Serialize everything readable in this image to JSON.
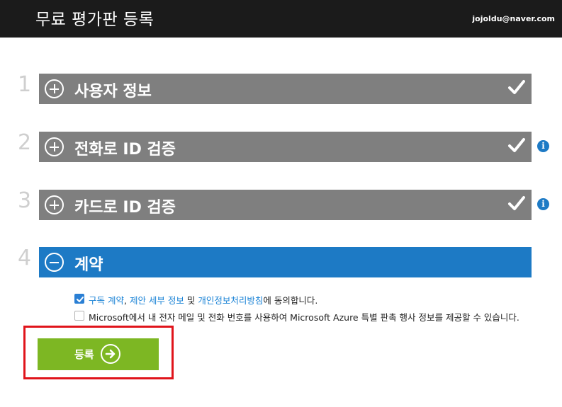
{
  "header": {
    "title": "무료 평가판 등록",
    "user_email": "jojoldu@naver.com"
  },
  "steps": [
    {
      "number": "1",
      "label": "사용자 정보",
      "expanded": false,
      "completed": true,
      "info": false
    },
    {
      "number": "2",
      "label": "전화로 ID 검증",
      "expanded": false,
      "completed": true,
      "info": true
    },
    {
      "number": "3",
      "label": "카드로 ID 검증",
      "expanded": false,
      "completed": true,
      "info": true
    },
    {
      "number": "4",
      "label": "계약",
      "expanded": true,
      "completed": false,
      "info": false
    }
  ],
  "agreement": {
    "terms": {
      "checked": true,
      "link_subscription": "구독 계약",
      "sep1": ", ",
      "link_offer": "제안 세부 정보",
      "sep2": " 및 ",
      "link_privacy": "개인정보처리방침",
      "suffix": "에 동의합니다."
    },
    "marketing": {
      "checked": false,
      "text": "Microsoft에서 내 전자 메일 및 전화 번호를 사용하여 Microsoft Azure 특별 판촉 행사 정보를 제공할 수 있습니다."
    }
  },
  "submit": {
    "label": "등록",
    "icon": "arrow-right-circle-icon"
  },
  "colors": {
    "header_bg": "#1b1b1b",
    "step_bar": "#7f7f7f",
    "step_bar_active": "#1d7ac5",
    "link": "#1a83d6",
    "submit_bg": "#7db723",
    "highlight": "#e0141b"
  }
}
